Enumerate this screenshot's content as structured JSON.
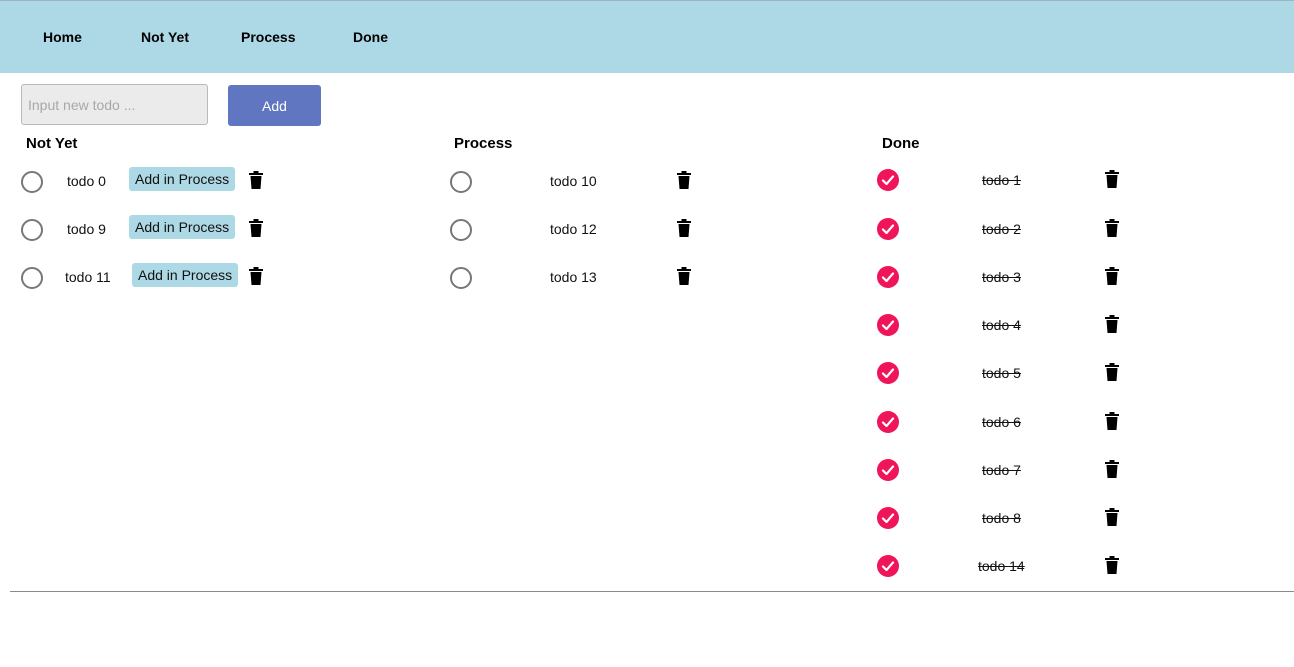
{
  "nav": {
    "home": "Home",
    "not_yet": "Not Yet",
    "process": "Process",
    "done": "Done"
  },
  "form": {
    "input_value": "",
    "input_placeholder": "Input new todo ...",
    "add_label": "Add"
  },
  "columns": {
    "not_yet": {
      "title": "Not Yet",
      "items": [
        {
          "text": "todo 0",
          "action": "Add in Process"
        },
        {
          "text": "todo 9",
          "action": "Add in Process"
        },
        {
          "text": "todo 11",
          "action": "Add in Process"
        }
      ]
    },
    "process": {
      "title": "Process",
      "items": [
        {
          "text": "todo 10"
        },
        {
          "text": "todo 12"
        },
        {
          "text": "todo 13"
        }
      ]
    },
    "done": {
      "title": "Done",
      "items": [
        {
          "text": "todo 1"
        },
        {
          "text": "todo 2"
        },
        {
          "text": "todo 3"
        },
        {
          "text": "todo 4"
        },
        {
          "text": "todo 5"
        },
        {
          "text": "todo 6"
        },
        {
          "text": "todo 7"
        },
        {
          "text": "todo 8"
        },
        {
          "text": "todo 14"
        }
      ]
    }
  },
  "icons": {
    "unchecked": "radio-unchecked-icon",
    "checked": "check-circle-icon",
    "delete": "trash-icon"
  },
  "colors": {
    "topbar": "#add8e6",
    "add_button": "#6076c0",
    "process_button": "#add8e6",
    "done_check": "#f0145a"
  }
}
